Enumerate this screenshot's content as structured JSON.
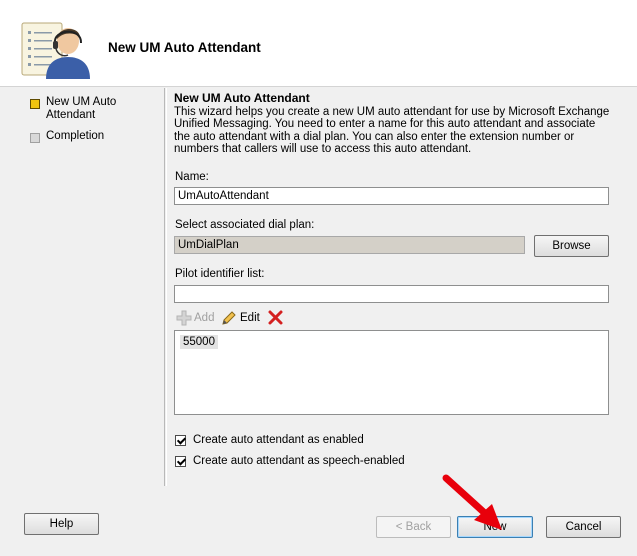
{
  "header": {
    "title": "New UM Auto Attendant"
  },
  "steps": [
    {
      "label": "New UM Auto Attendant",
      "state": "current"
    },
    {
      "label": "Completion",
      "state": "pending"
    }
  ],
  "page": {
    "section_title": "New UM Auto Attendant",
    "description": "This wizard helps you create a new UM auto attendant for use by Microsoft Exchange Unified Messaging. You need to enter a name for this auto attendant and associate the auto attendant with a dial plan. You can also enter the extension number or numbers that callers will use to access this auto attendant.",
    "name_label": "Name:",
    "name_value": "UmAutoAttendant",
    "dialplan_label": "Select associated dial plan:",
    "dialplan_value": "UmDialPlan",
    "browse_label": "Browse",
    "pilot_label": "Pilot identifier list:",
    "pilot_value": "",
    "add_label": "Add",
    "edit_label": "Edit",
    "pilot_items": [
      "55000"
    ],
    "check_enabled_label": "Create auto attendant as enabled",
    "check_enabled": true,
    "check_speech_label": "Create auto attendant as speech-enabled",
    "check_speech": true
  },
  "footer": {
    "help_label": "Help",
    "back_label": "< Back",
    "new_label": "New",
    "cancel_label": "Cancel"
  },
  "colors": {
    "current_step": "#f1c40f",
    "arrow": "#e8000b",
    "remove_icon": "#d42020"
  }
}
